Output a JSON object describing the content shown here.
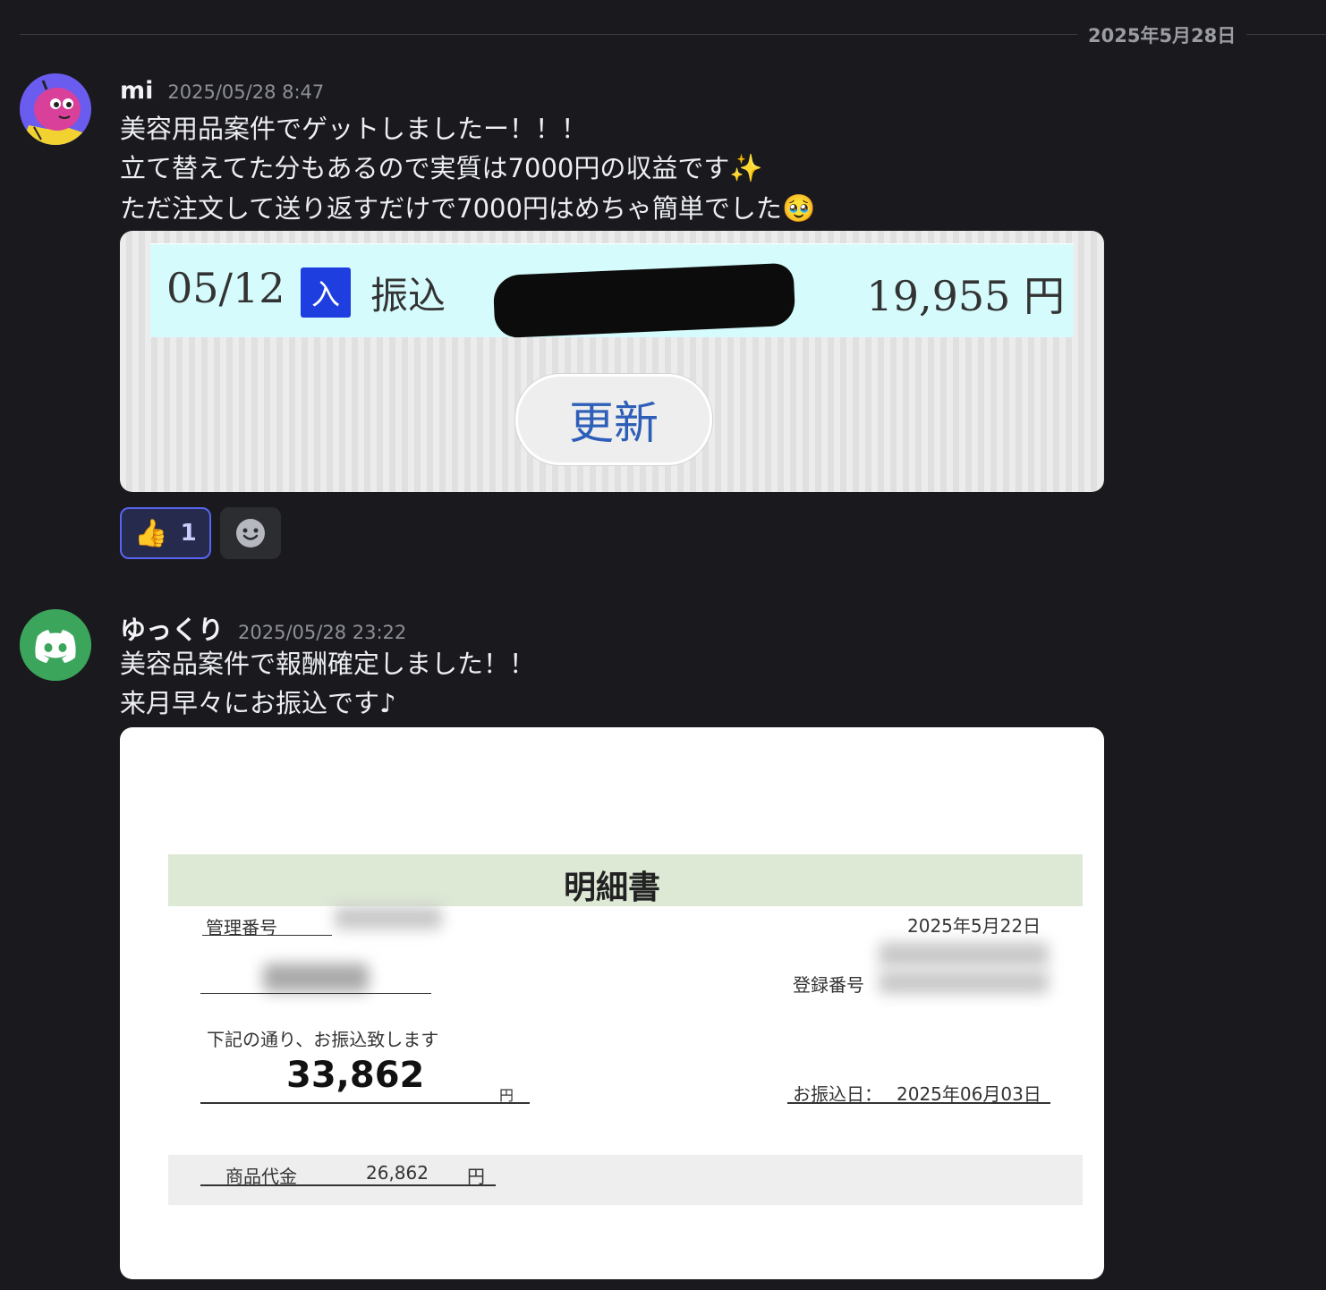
{
  "date_divider": "2025年5月28日",
  "messages": [
    {
      "author": "mi",
      "timestamp": "2025/05/28 8:47",
      "lines": [
        "美容用品案件でゲットしましたー！！！",
        "立て替えてた分もあるので実質は7000円の収益です",
        "ただ注文して送り返すだけで7000円はめちゃ簡単でした"
      ],
      "line2_emoji": "✨",
      "line3_emoji": "🥹",
      "attachment": {
        "date": "05/12",
        "badge": "入",
        "type": "振込",
        "amount": "19,955 円",
        "button": "更新"
      },
      "reactions": [
        {
          "emoji": "👍",
          "count": "1"
        }
      ]
    },
    {
      "author": "ゆっくり",
      "timestamp": "2025/05/28 23:22",
      "lines": [
        "美容品案件で報酬確定しました！！",
        "来月早々にお振込です♪"
      ],
      "attachment": {
        "title": "明細書",
        "mgmt_label": "管理番号",
        "issue_date": "2025年5月22日",
        "reg_label": "登録番号",
        "notice": "下記の通り、お振込致します",
        "total": "33,862",
        "yen": "円",
        "transfer_label": "お振込日：",
        "transfer_date": "2025年06月03日",
        "item_label": "商品代金",
        "item_amount": "26,862",
        "item_yen": "円"
      }
    }
  ],
  "colors": {
    "background": "#1a1a1e",
    "accent": "#5865f2",
    "discord_green": "#3ba55c"
  }
}
